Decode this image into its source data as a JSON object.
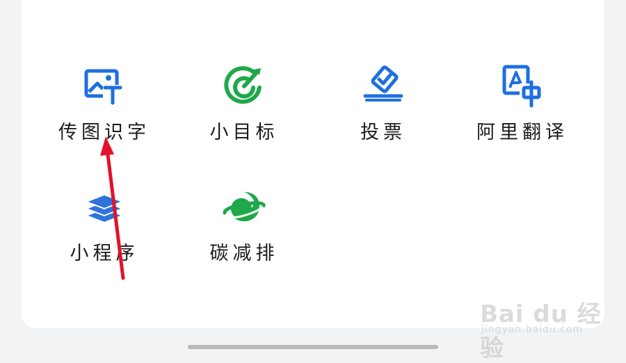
{
  "apps": [
    {
      "label": "传图识字",
      "icon": "image-text-icon",
      "color": "#1e6fe0"
    },
    {
      "label": "小目标",
      "icon": "target-icon",
      "color": "#1fa84a"
    },
    {
      "label": "投票",
      "icon": "vote-box-icon",
      "color": "#1e6fe0"
    },
    {
      "label": "阿里翻译",
      "icon": "translate-icon",
      "color": "#1e6fe0"
    },
    {
      "label": "小程序",
      "icon": "layers-icon",
      "color": "#2f73dc"
    },
    {
      "label": "碳减排",
      "icon": "planet-leaf-icon",
      "color": "#1fa84a"
    }
  ],
  "annotation": {
    "arrow_color": "#e3122a"
  },
  "watermark": {
    "brand": "Bai du 经验",
    "url": "jingyan.baidu.com"
  }
}
